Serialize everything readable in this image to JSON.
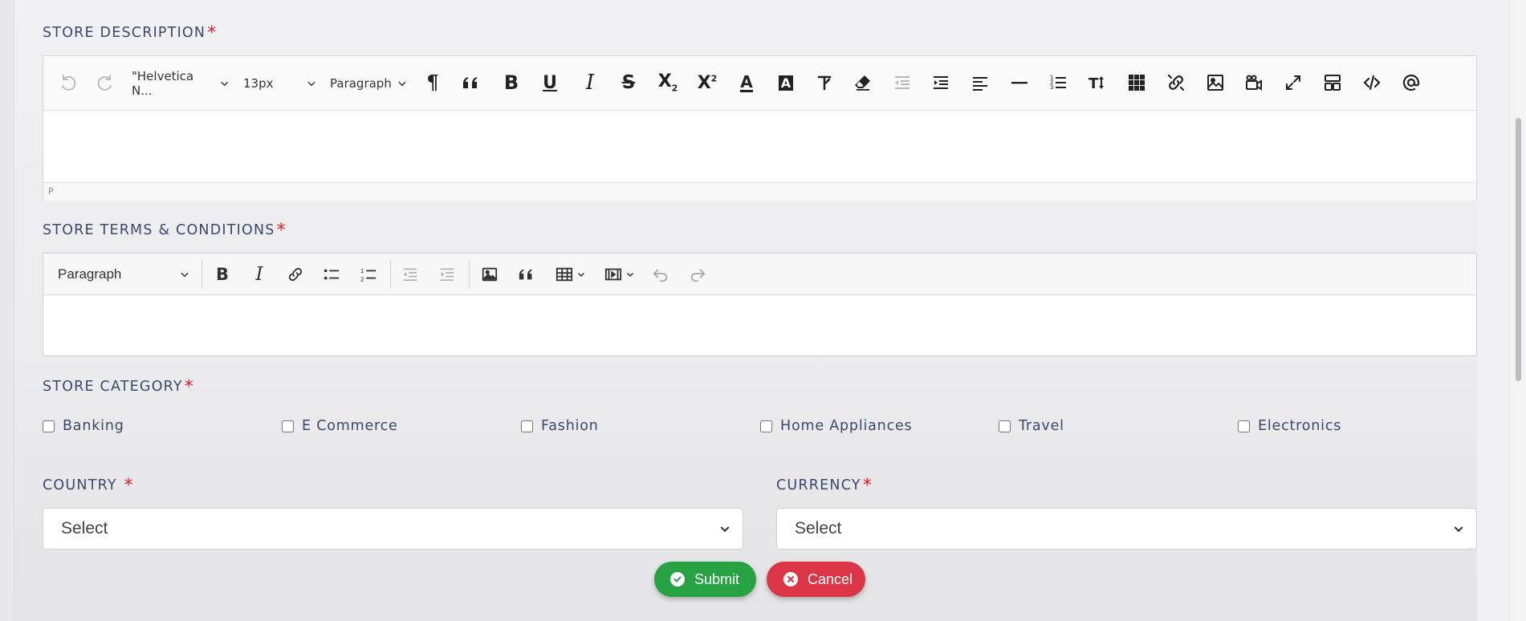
{
  "store_description": {
    "label": "STORE DESCRIPTION",
    "required_mark": "*",
    "font_family_select": "\"Helvetica N...",
    "font_size_select": "13px",
    "block_format_select": "Paragraph",
    "status_path": "P",
    "toolbar_icons": [
      "undo-icon",
      "redo-icon",
      "pilcrow-icon",
      "blockquote-icon",
      "bold-icon",
      "underline-icon",
      "italic-icon",
      "strikethrough-icon",
      "subscript-icon",
      "superscript-icon",
      "text-color-icon",
      "background-color-icon",
      "clear-format-icon",
      "eraser-icon",
      "outdent-icon",
      "indent-icon",
      "align-left-icon",
      "horizontal-rule-icon",
      "ordered-list-icon",
      "line-height-icon",
      "table-grid-icon",
      "unlink-icon",
      "image-icon",
      "video-icon",
      "fullscreen-icon",
      "template-icon",
      "code-view-icon",
      "mention-icon"
    ]
  },
  "store_terms": {
    "label": "STORE TERMS & CONDITIONS",
    "required_mark": "*",
    "heading_select": "Paragraph",
    "toolbar_icons": [
      "bold-icon",
      "italic-icon",
      "link-icon",
      "bulleted-list-icon",
      "numbered-list-icon",
      "outdent-icon",
      "indent-icon",
      "image-icon",
      "blockquote-icon",
      "table-icon",
      "media-embed-icon",
      "undo-icon",
      "redo-icon"
    ]
  },
  "store_category": {
    "label": "STORE CATEGORY",
    "required_mark": "*",
    "options": [
      "Banking",
      "E Commerce",
      "Fashion",
      "Home Appliances",
      "Travel",
      "Electronics"
    ]
  },
  "country": {
    "label": "COUNTRY",
    "required_mark": "*",
    "value": "Select"
  },
  "currency": {
    "label": "CURRENCY",
    "required_mark": "*",
    "value": "Select"
  },
  "actions": {
    "submit_label": "Submit",
    "cancel_label": "Cancel",
    "submit_color": "#27a243",
    "cancel_color": "#dc3545"
  }
}
